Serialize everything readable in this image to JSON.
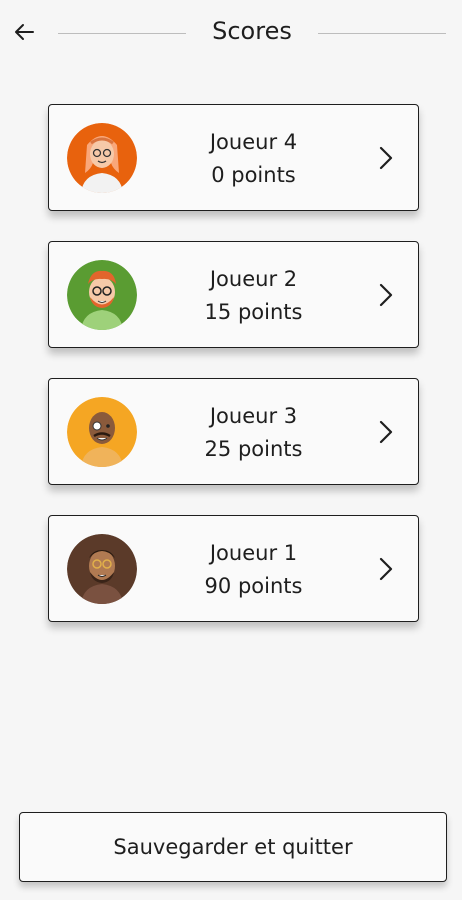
{
  "header": {
    "title": "Scores",
    "back_icon": "arrow-left-icon"
  },
  "players": [
    {
      "name": "Joueur 4",
      "score": "0 points",
      "avatar_bg": "#e8620d"
    },
    {
      "name": "Joueur 2",
      "score": "15 points",
      "avatar_bg": "#5a9c32"
    },
    {
      "name": "Joueur 3",
      "score": "25 points",
      "avatar_bg": "#f5a623"
    },
    {
      "name": "Joueur 1",
      "score": "90 points",
      "avatar_bg": "#5b3a29"
    }
  ],
  "footer": {
    "save_label": "Sauvegarder et quitter"
  }
}
